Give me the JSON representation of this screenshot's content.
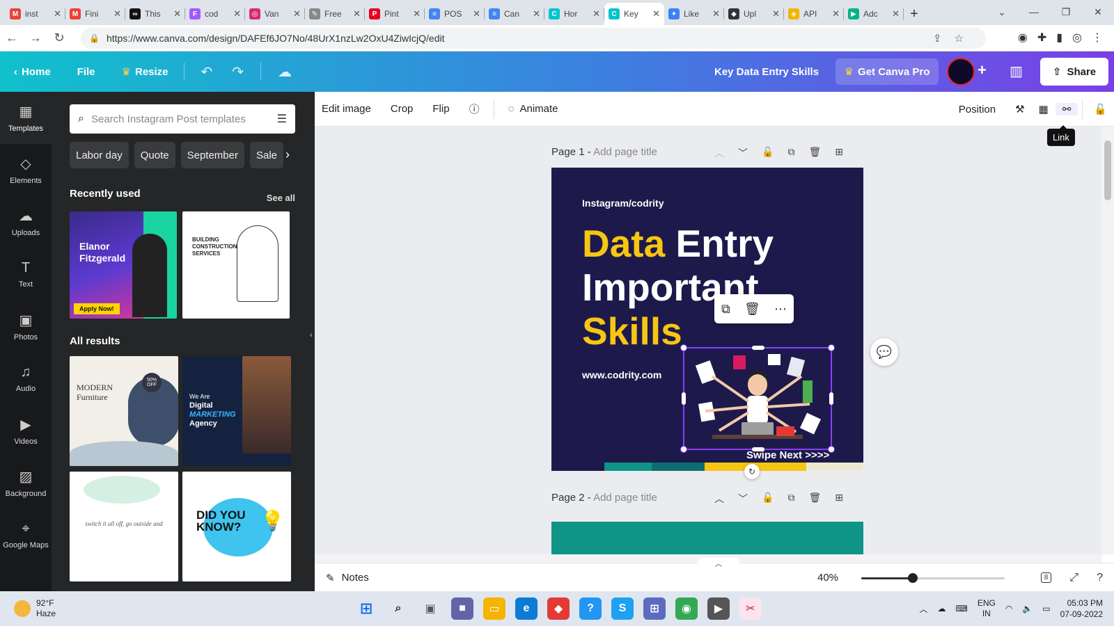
{
  "browser": {
    "tabs": [
      {
        "title": "inst",
        "color": "#ea4335",
        "glyph": "M"
      },
      {
        "title": "Fini",
        "color": "#ea4335",
        "glyph": "M"
      },
      {
        "title": "This",
        "color": "#111111",
        "glyph": "∞"
      },
      {
        "title": "cod",
        "color": "#a259ff",
        "glyph": "F"
      },
      {
        "title": "Van",
        "color": "#d62976",
        "glyph": "◎"
      },
      {
        "title": "Free",
        "color": "#888888",
        "glyph": "✎"
      },
      {
        "title": "Pint",
        "color": "#e60023",
        "glyph": "P"
      },
      {
        "title": "POS",
        "color": "#4285f4",
        "glyph": "≡"
      },
      {
        "title": "Can",
        "color": "#4285f4",
        "glyph": "≡"
      },
      {
        "title": "Hor",
        "color": "#00c4cc",
        "glyph": "C"
      },
      {
        "title": "Key",
        "color": "#00c4cc",
        "glyph": "C",
        "active": true
      },
      {
        "title": "Like",
        "color": "#3b82f6",
        "glyph": "✦"
      },
      {
        "title": "Upl",
        "color": "#333333",
        "glyph": "◆"
      },
      {
        "title": "API",
        "color": "#f4b400",
        "glyph": "◈"
      },
      {
        "title": "Adc",
        "color": "#00b386",
        "glyph": "▶"
      }
    ],
    "url": "https://www.canva.com/design/DAFEf6JO7No/48UrX1nzLw2OxU4ZiwIcjQ/edit"
  },
  "header": {
    "home": "Home",
    "file": "File",
    "resize": "Resize",
    "doc_title": "Key Data Entry Skills",
    "get_pro": "Get Canva Pro",
    "share": "Share"
  },
  "rail": [
    {
      "label": "Templates",
      "icon": "▦",
      "name": "templates"
    },
    {
      "label": "Elements",
      "icon": "◇",
      "name": "elements"
    },
    {
      "label": "Uploads",
      "icon": "☁",
      "name": "uploads"
    },
    {
      "label": "Text",
      "icon": "T",
      "name": "text"
    },
    {
      "label": "Photos",
      "icon": "▣",
      "name": "photos"
    },
    {
      "label": "Audio",
      "icon": "♫",
      "name": "audio"
    },
    {
      "label": "Videos",
      "icon": "▶",
      "name": "videos"
    },
    {
      "label": "Background",
      "icon": "▨",
      "name": "background"
    },
    {
      "label": "Google Maps",
      "icon": "⌖",
      "name": "google-maps"
    }
  ],
  "panel": {
    "search_placeholder": "Search Instagram Post templates",
    "chips": [
      "Labor day",
      "Quote",
      "September",
      "Sale"
    ],
    "recently_used": "Recently used",
    "see_all": "See all",
    "all_results": "All results",
    "templates": {
      "elanor": {
        "name": "Elanor Fitzgerald",
        "cta": "Apply Now!"
      },
      "construction": {
        "title": "BUILDING CONSTRUCTION SERVICES"
      },
      "furniture": {
        "title": "MODERN Furniture",
        "badge": "50% OFF"
      },
      "marketing": {
        "pre": "We Are",
        "line1": "Digital",
        "line2": "MARKETING",
        "line3": "Agency"
      },
      "quote": {
        "text": "switch it all off, go outside and"
      },
      "didyouknow": {
        "title": "DID YOU KNOW?"
      }
    }
  },
  "toolbar": {
    "edit_image": "Edit image",
    "crop": "Crop",
    "flip": "Flip",
    "animate": "Animate",
    "position": "Position",
    "tooltip": "Link"
  },
  "pages": [
    {
      "label": "Page 1 -",
      "title_placeholder": "Add page title"
    },
    {
      "label": "Page 2 -",
      "title_placeholder": "Add page title"
    }
  ],
  "design": {
    "handle": "Instagram/codrity",
    "title_word1": "Data",
    "title_word2": "Entry",
    "title_line2": "Important",
    "title_line3": "Skills",
    "url": "www.codrity.com",
    "swipe": "Swipe Next >>>>",
    "colors": {
      "bg": "#1d1a4b",
      "accent": "#f7c613",
      "teal": "#0f9488"
    }
  },
  "footer": {
    "notes": "Notes",
    "zoom": "40%",
    "zoom_fraction": 0.36,
    "page_count": "8"
  },
  "taskbar": {
    "temp": "92°F",
    "condition": "Haze",
    "lang1": "ENG",
    "lang2": "IN",
    "time": "05:03 PM",
    "date": "07-09-2022"
  }
}
